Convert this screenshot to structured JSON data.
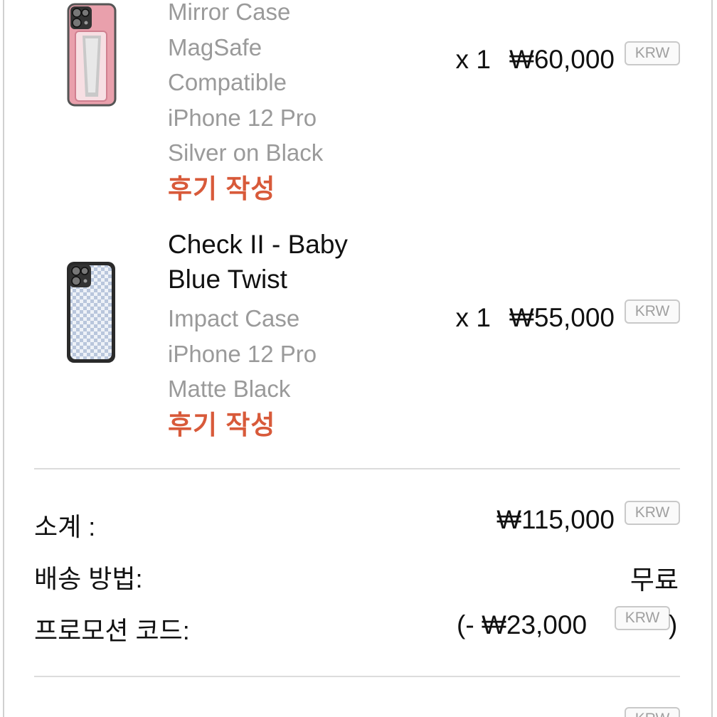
{
  "items": [
    {
      "title_lines": [],
      "detail_lines": [
        "Mirror Case",
        "MagSafe",
        "Compatible",
        "iPhone 12 Pro",
        "Silver on Black"
      ],
      "review_label": "후기 작성",
      "quantity": "x 1",
      "price": "₩60,000",
      "currency": "KRW",
      "thumbnail_icon": "pink-mirror-phone-case-icon"
    },
    {
      "title_lines": [
        "Check II - Baby",
        "Blue Twist"
      ],
      "detail_lines": [
        "Impact Case",
        "iPhone 12 Pro",
        "Matte Black"
      ],
      "review_label": "후기 작성",
      "quantity": "x 1",
      "price": "₩55,000",
      "currency": "KRW",
      "thumbnail_icon": "blue-check-phone-case-icon"
    }
  ],
  "summary": {
    "subtotal_label": "소계 :",
    "subtotal_value": "₩115,000",
    "subtotal_currency": "KRW",
    "shipping_label": "배송 방법:",
    "shipping_value": "무료",
    "promo_label": "프로모션 코드:",
    "promo_prefix": "(-",
    "promo_value": "₩23,000",
    "promo_currency": "KRW",
    "promo_suffix": ")",
    "total_currency": "KRW"
  },
  "colors": {
    "review_link": "#d85a3a",
    "muted_text": "#9a9a9a",
    "divider": "#dcdcdc"
  }
}
